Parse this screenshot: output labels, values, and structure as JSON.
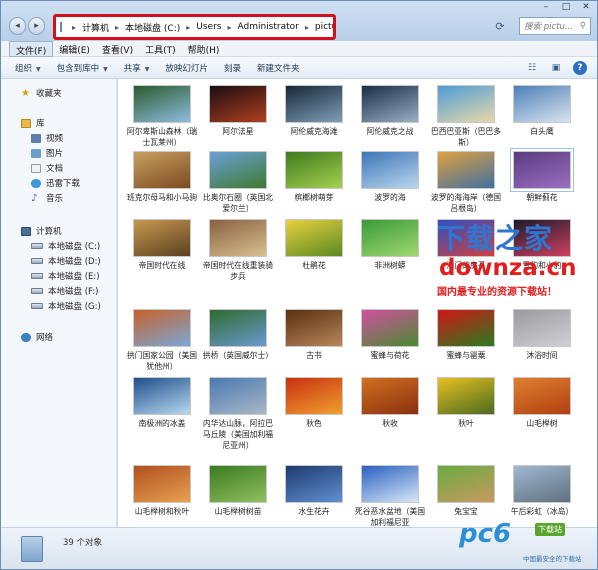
{
  "address": {
    "crumbs": [
      "计算机",
      "本地磁盘 (C:)",
      "Users",
      "Administrator",
      "pictures"
    ],
    "search_placeholder": "搜索 pictu..."
  },
  "menu": [
    "文件(F)",
    "编辑(E)",
    "查看(V)",
    "工具(T)",
    "帮助(H)"
  ],
  "toolbar": {
    "organize": "组织",
    "include_in_library": "包含到库中",
    "share": "共享",
    "slideshow": "放映幻灯片",
    "burn": "刻录",
    "new_folder": "新建文件夹"
  },
  "nav": {
    "favorites": "收藏夹",
    "library": "库",
    "video": "视频",
    "pictures": "图片",
    "documents": "文档",
    "xunlei": "迅雷下载",
    "music": "音乐",
    "computer": "计算机",
    "drives": [
      "本地磁盘 (C:)",
      "本地磁盘 (D:)",
      "本地磁盘 (E:)",
      "本地磁盘 (F:)",
      "本地磁盘 (G:)"
    ],
    "network": "网络"
  },
  "files": [
    {
      "name": "阿尔卑斯山森林（瑞士瓦莱州）",
      "colors": [
        "#2a5a2e",
        "#8fbde0"
      ]
    },
    {
      "name": "阿尔法星",
      "colors": [
        "#1a0c10",
        "#b04020"
      ]
    },
    {
      "name": "阿伦威克海滩",
      "colors": [
        "#172838",
        "#7f9eb8"
      ]
    },
    {
      "name": "阿伦威克之战",
      "colors": [
        "#1d2d47",
        "#9aaec4"
      ]
    },
    {
      "name": "巴西巴亚斯（巴巴多斯）",
      "colors": [
        "#4f9cd6",
        "#e8d8a8"
      ]
    },
    {
      "name": "白头鹰",
      "colors": [
        "#4e7fb6",
        "#d8e4f0"
      ]
    },
    {
      "name": "班克尔母马和小马驹",
      "colors": [
        "#c8a060",
        "#7c4a20"
      ]
    },
    {
      "name": "比奥尔石圈（英国北爱尔兰）",
      "colors": [
        "#6aa0d8",
        "#3e7a30"
      ]
    },
    {
      "name": "槟榔树萌芽",
      "colors": [
        "#3d7a1e",
        "#a6d050"
      ]
    },
    {
      "name": "波罗的海",
      "colors": [
        "#3b76b8",
        "#bcd6ee"
      ]
    },
    {
      "name": "波罗的海海岸（德国吕根岛）",
      "colors": [
        "#e0a040",
        "#4070a0"
      ]
    },
    {
      "name": "朝鲜蓟花",
      "colors": [
        "#5a3a80",
        "#9a70c0"
      ]
    },
    {
      "name": "帝国时代在线",
      "colors": [
        "#c89850",
        "#5a4020"
      ]
    },
    {
      "name": "帝国时代在线重装骑步兵",
      "colors": [
        "#8a6040",
        "#d8c090"
      ]
    },
    {
      "name": "杜鹃花",
      "colors": [
        "#e8d040",
        "#5a8a20"
      ]
    },
    {
      "name": "非洲树蟒",
      "colors": [
        "#3a9a3a",
        "#a0d870"
      ]
    },
    {
      "name": "澳门的房子",
      "colors": [
        "#3050c0",
        "#d04040"
      ]
    },
    {
      "name": "雪豹和小豹",
      "colors": [
        "#1a1a2a",
        "#d04060"
      ]
    },
    {
      "name": "拱门国家公园（美国犹他州）",
      "colors": [
        "#c8602a",
        "#7aa8d8"
      ]
    },
    {
      "name": "拱桥（英国威尔士）",
      "colors": [
        "#2e6a2e",
        "#6a9ad0"
      ]
    },
    {
      "name": "古书",
      "colors": [
        "#5a3010",
        "#b8865a"
      ]
    },
    {
      "name": "蜜蜂与荷花",
      "colors": [
        "#d050a0",
        "#4a8a30"
      ]
    },
    {
      "name": "蜜蜂与罂粟",
      "colors": [
        "#d01818",
        "#2a7a20"
      ]
    },
    {
      "name": "沐浴时间",
      "colors": [
        "#9a9aa0",
        "#d0d0d4"
      ]
    },
    {
      "name": "南极洲的冰盖",
      "colors": [
        "#1e4e8a",
        "#b8d8f0"
      ]
    },
    {
      "name": "内华达山脉，阿拉巴马丘陵（美国加利福尼亚州）",
      "colors": [
        "#4a78b0",
        "#a8b8c8"
      ]
    },
    {
      "name": "秋色",
      "colors": [
        "#c83010",
        "#f0a030"
      ]
    },
    {
      "name": "秋收",
      "colors": [
        "#d07020",
        "#8a3010"
      ]
    },
    {
      "name": "秋叶",
      "colors": [
        "#e8c020",
        "#4a6a20"
      ]
    },
    {
      "name": "山毛榉树",
      "colors": [
        "#e08030",
        "#b04010"
      ]
    },
    {
      "name": "山毛榉树和秋叶",
      "colors": [
        "#b05020",
        "#e8a050"
      ]
    },
    {
      "name": "山毛榉树树苗",
      "colors": [
        "#3a7a20",
        "#90c060"
      ]
    },
    {
      "name": "水生花卉",
      "colors": [
        "#1e3a70",
        "#6090d0"
      ]
    },
    {
      "name": "死谷恶水盆地（美国加利福尼亚",
      "colors": [
        "#2a60c0",
        "#d8e8f8"
      ]
    },
    {
      "name": "兔宝宝",
      "colors": [
        "#6aaa40",
        "#c89a60"
      ]
    },
    {
      "name": "午后彩虹（冰岛）",
      "colors": [
        "#a0b8d0",
        "#607080"
      ]
    }
  ],
  "status": {
    "count": "39 个对象"
  },
  "watermark": {
    "title": "下载之家",
    "url": "downza.cn",
    "sub": "国内最专业的资源下载站！",
    "logo": "pc6",
    "badge": "下载站",
    "logo_sub": "中国最安全的下载站"
  }
}
